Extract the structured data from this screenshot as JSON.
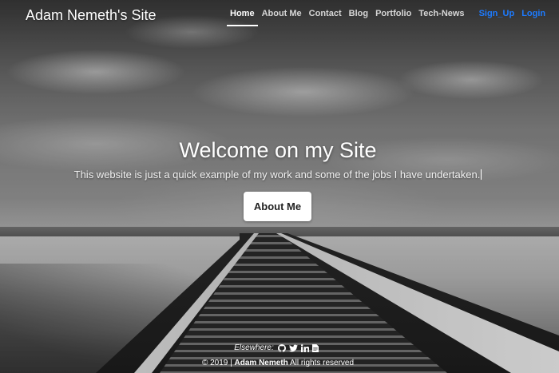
{
  "header": {
    "brand": "Adam Nemeth's Site",
    "nav": [
      {
        "label": "Home",
        "active": true
      },
      {
        "label": "About Me",
        "active": false
      },
      {
        "label": "Contact",
        "active": false
      },
      {
        "label": "Blog",
        "active": false
      },
      {
        "label": "Portfolio",
        "active": false
      },
      {
        "label": "Tech-News",
        "active": false
      }
    ],
    "auth": {
      "signup": "Sign_Up",
      "login": "Login"
    },
    "auth_color": "#1d7bff"
  },
  "hero": {
    "title": "Welcome on my Site",
    "subtitle": "This website is just a quick example of my work and some of the jobs I have undertaken.",
    "button": "About Me"
  },
  "footer": {
    "elsewhere_label": "Elsewhere:",
    "social_icons": [
      "github-icon",
      "twitter-icon",
      "linkedin-icon",
      "document-icon"
    ],
    "copyright_prefix": "© 2019 |",
    "copyright_name": "Adam Nemeth",
    "copyright_suffix": "All rights reserved"
  }
}
